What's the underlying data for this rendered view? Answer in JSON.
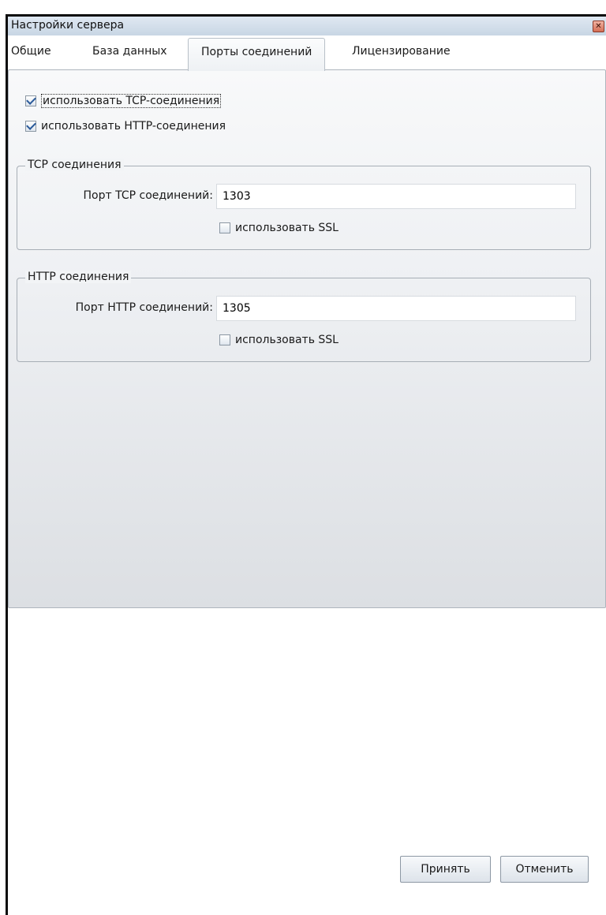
{
  "window": {
    "title": "Настройки сервера",
    "close_glyph": "✕"
  },
  "tabs": [
    {
      "label": "Общие"
    },
    {
      "label": "База данных"
    },
    {
      "label": "Порты соединений",
      "active": true
    },
    {
      "label": "Лицензирование"
    }
  ],
  "options": {
    "use_tcp": {
      "label": "использовать TCP-соединения",
      "checked": true
    },
    "use_http": {
      "label": "использовать HTTP-соединения",
      "checked": true
    }
  },
  "tcp_group": {
    "legend": "TCP соединения",
    "port_label": "Порт TCP соединений:",
    "port_value": "1303",
    "ssl_label": "использовать SSL",
    "ssl_checked": false
  },
  "http_group": {
    "legend": "HTTP соединения",
    "port_label": "Порт HTTP соединений:",
    "port_value": "1305",
    "ssl_label": "использовать SSL",
    "ssl_checked": false
  },
  "buttons": {
    "accept": "Принять",
    "cancel": "Отменить"
  },
  "colors": {
    "titlebar": "#c8d6e4",
    "panel": "#eef0f3",
    "checkmark": "#2a5a9a",
    "close": "#d46e55"
  }
}
